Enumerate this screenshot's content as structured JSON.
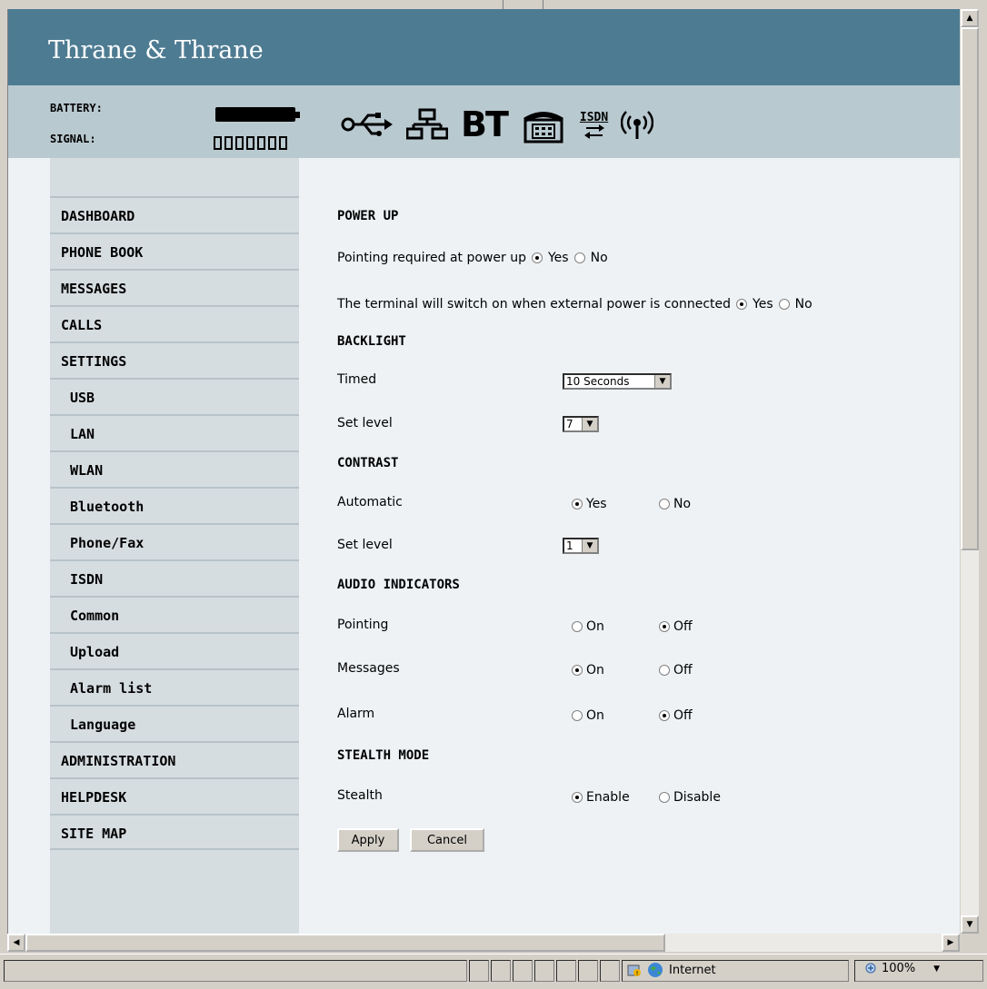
{
  "brand": "Thrane & Thrane",
  "status": {
    "battery_label": "BATTERY:",
    "signal_label": "SIGNAL:",
    "signal_bars": 7,
    "interface_icons": [
      "usb-icon",
      "lan-icon",
      "bluetooth-icon",
      "phone-fax-icon",
      "isdn-icon",
      "wlan-icon"
    ],
    "bt_text": "BT",
    "isdn_text": "ISDN"
  },
  "nav": [
    {
      "label": "DASHBOARD",
      "sub": false
    },
    {
      "label": "PHONE BOOK",
      "sub": false
    },
    {
      "label": "MESSAGES",
      "sub": false
    },
    {
      "label": "CALLS",
      "sub": false
    },
    {
      "label": "SETTINGS",
      "sub": false
    },
    {
      "label": "USB",
      "sub": true
    },
    {
      "label": "LAN",
      "sub": true
    },
    {
      "label": "WLAN",
      "sub": true
    },
    {
      "label": "Bluetooth",
      "sub": true
    },
    {
      "label": "Phone/Fax",
      "sub": true
    },
    {
      "label": "ISDN",
      "sub": true
    },
    {
      "label": "Common",
      "sub": true
    },
    {
      "label": "Upload",
      "sub": true
    },
    {
      "label": "Alarm list",
      "sub": true
    },
    {
      "label": "Language",
      "sub": true
    },
    {
      "label": "ADMINISTRATION",
      "sub": false
    },
    {
      "label": "HELPDESK",
      "sub": false
    },
    {
      "label": "SITE MAP",
      "sub": false
    }
  ],
  "form": {
    "power_up": {
      "heading": "POWER UP",
      "pointing_label": "Pointing required at power up",
      "external_label": "The terminal will switch on when external power is connected",
      "yes": "Yes",
      "no": "No",
      "pointing_value": "Yes",
      "external_value": "Yes"
    },
    "backlight": {
      "heading": "BACKLIGHT",
      "timed_label": "Timed",
      "timed_value": "10 Seconds",
      "level_label": "Set level",
      "level_value": "7"
    },
    "contrast": {
      "heading": "CONTRAST",
      "automatic_label": "Automatic",
      "yes": "Yes",
      "no": "No",
      "automatic_value": "Yes",
      "level_label": "Set level",
      "level_value": "1"
    },
    "audio": {
      "heading": "AUDIO INDICATORS",
      "on": "On",
      "off": "Off",
      "pointing_label": "Pointing",
      "pointing_value": "Off",
      "messages_label": "Messages",
      "messages_value": "On",
      "alarm_label": "Alarm",
      "alarm_value": "Off"
    },
    "stealth": {
      "heading": "STEALTH MODE",
      "stealth_label": "Stealth",
      "enable": "Enable",
      "disable": "Disable",
      "stealth_value": "Enable"
    },
    "apply": "Apply",
    "cancel": "Cancel"
  },
  "browser_status": {
    "zone": "Internet",
    "zoom": "100%"
  },
  "colors": {
    "header": "#4d7b92",
    "status_band": "#b9c9d0",
    "sidebar": "#d6dde1",
    "content": "#eef2f5"
  }
}
